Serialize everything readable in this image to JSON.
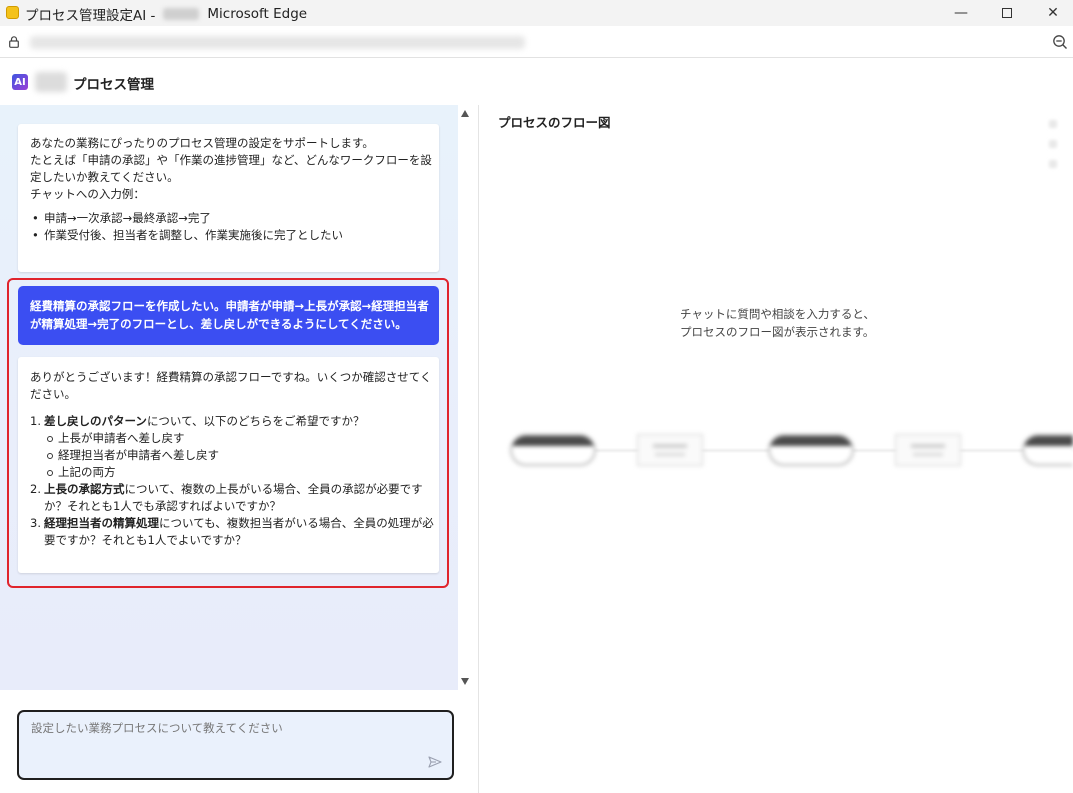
{
  "window": {
    "title_prefix": "プロセス管理設定AI -",
    "title_suffix": "Microsoft Edge",
    "minimize_glyph": "—",
    "close_glyph": "✕"
  },
  "app": {
    "logo_text": "AI",
    "title": "プロセス管理"
  },
  "chat": {
    "intro": {
      "lines": [
        "あなたの業務にぴったりのプロセス管理の設定をサポートします。",
        "たとえば「申請の承認」や「作業の進捗管理」など、どんなワークフローを設",
        "定したいか教えてください。",
        "チャットへの入力例："
      ],
      "examples": [
        "申請→一次承認→最終承認→完了",
        "作業受付後、担当者を調整し、作業実施後に完了としたい"
      ]
    },
    "user_message": {
      "lines": [
        "経費精算の承認フローを作成したい。申請者が申請→上長が承認→経理担当者",
        "が精算処理→完了のフローとし、差し戻しができるようにしてください。"
      ]
    },
    "reply": {
      "intro_lines": [
        "ありがとうございます！経費精算の承認フローですね。いくつか確認させてく",
        "ださい。"
      ],
      "questions": [
        {
          "number": "1.",
          "bold": "差し戻しのパターン",
          "rest": "について、以下のどちらをご希望ですか？",
          "continuation": "",
          "options": [
            "上長が申請者へ差し戻す",
            "経理担当者が申請者へ差し戻す",
            "上記の両方"
          ]
        },
        {
          "number": "2.",
          "bold": "上長の承認方式",
          "rest": "について、複数の上長がいる場合、全員の承認が必要です",
          "continuation": "か？それとも1人でも承認すればよいですか？",
          "options": []
        },
        {
          "number": "3.",
          "bold": "経理担当者の精算処理",
          "rest": "についても、複数担当者がいる場合、全員の処理が必",
          "continuation": "要ですか？それとも1人でよいですか？",
          "options": []
        }
      ]
    },
    "input": {
      "placeholder": "設定したい業務プロセスについて教えてください"
    }
  },
  "flow": {
    "title": "プロセスのフロー図",
    "empty_message_lines": [
      "チャットに質問や相談を入力すると、",
      "プロセスのフロー図が表示されます。"
    ]
  },
  "colors": {
    "user_bubble": "#3b4ef2",
    "highlight_border": "#e0242c",
    "chat_background": "#e8f2fb"
  }
}
